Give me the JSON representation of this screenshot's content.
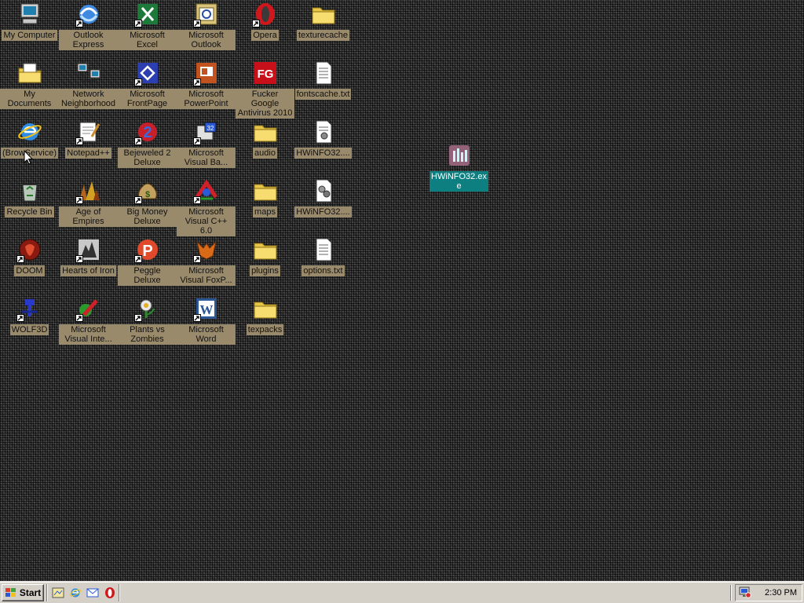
{
  "desktop": {
    "icons": [
      {
        "id": "my-computer",
        "label": "My Computer",
        "icon": "my-computer-icon",
        "shortcut": false
      },
      {
        "id": "outlook-express",
        "label": "Outlook Express",
        "icon": "outlook-express-icon",
        "shortcut": true
      },
      {
        "id": "microsoft-excel",
        "label": "Microsoft Excel",
        "icon": "excel-icon",
        "shortcut": true
      },
      {
        "id": "microsoft-outlook",
        "label": "Microsoft Outlook",
        "icon": "outlook-icon",
        "shortcut": true
      },
      {
        "id": "opera",
        "label": "Opera",
        "icon": "opera-icon",
        "shortcut": true
      },
      {
        "id": "texturecache",
        "label": "texturecache",
        "icon": "folder-icon",
        "shortcut": false
      },
      {
        "id": "my-documents",
        "label": "My Documents",
        "icon": "my-documents-icon",
        "shortcut": false
      },
      {
        "id": "network-neighborhood",
        "label": "Network Neighborhood",
        "icon": "network-icon",
        "shortcut": false
      },
      {
        "id": "microsoft-frontpage",
        "label": "Microsoft FrontPage",
        "icon": "frontpage-icon",
        "shortcut": true
      },
      {
        "id": "microsoft-powerpoint",
        "label": "Microsoft PowerPoint",
        "icon": "powerpoint-icon",
        "shortcut": true
      },
      {
        "id": "fucker-google",
        "label": "Fucker Google Antivirus 2010",
        "icon": "fg-antivirus-icon",
        "shortcut": false
      },
      {
        "id": "fontscache",
        "label": "fontscache.txt",
        "icon": "text-file-icon",
        "shortcut": false
      },
      {
        "id": "browservice",
        "label": "(BrowService)",
        "icon": "internet-explorer-icon",
        "shortcut": false
      },
      {
        "id": "notepadpp",
        "label": "Notepad++",
        "icon": "notepad-icon",
        "shortcut": true
      },
      {
        "id": "bejeweled",
        "label": "Bejeweled 2 Deluxe",
        "icon": "bejeweled-icon",
        "shortcut": true
      },
      {
        "id": "visual-basic",
        "label": "Microsoft Visual Ba...",
        "icon": "visual-basic-icon",
        "shortcut": true
      },
      {
        "id": "audio",
        "label": "audio",
        "icon": "folder-icon",
        "shortcut": false
      },
      {
        "id": "hwinfo-1",
        "label": "HWiNFO32....",
        "icon": "config-file-icon",
        "shortcut": false
      },
      {
        "id": "recycle-bin",
        "label": "Recycle Bin",
        "icon": "recycle-bin-icon",
        "shortcut": false
      },
      {
        "id": "age-of-empires",
        "label": "Age of Empires",
        "icon": "age-of-empires-icon",
        "shortcut": true
      },
      {
        "id": "big-money",
        "label": "Big Money Deluxe",
        "icon": "money-bag-icon",
        "shortcut": true
      },
      {
        "id": "visual-cpp",
        "label": "Microsoft Visual C++ 6.0",
        "icon": "visual-cpp-icon",
        "shortcut": true
      },
      {
        "id": "maps",
        "label": "maps",
        "icon": "folder-icon",
        "shortcut": false
      },
      {
        "id": "hwinfo-2",
        "label": "HWiNFO32....",
        "icon": "settings-file-icon",
        "shortcut": false
      },
      {
        "id": "doom",
        "label": "DOOM",
        "icon": "doom-icon",
        "shortcut": true
      },
      {
        "id": "hearts-of-iron",
        "label": "Hearts of Iron",
        "icon": "hearts-of-iron-icon",
        "shortcut": true
      },
      {
        "id": "peggle",
        "label": "Peggle Deluxe",
        "icon": "peggle-icon",
        "shortcut": true
      },
      {
        "id": "visual-foxpro",
        "label": "Microsoft Visual FoxP...",
        "icon": "foxpro-icon",
        "shortcut": true
      },
      {
        "id": "plugins",
        "label": "plugins",
        "icon": "folder-icon",
        "shortcut": false
      },
      {
        "id": "options",
        "label": "options.txt",
        "icon": "text-file-icon",
        "shortcut": false
      },
      {
        "id": "wolf3d",
        "label": "WOLF3D",
        "icon": "wolf3d-icon",
        "shortcut": true
      },
      {
        "id": "visual-interdev",
        "label": "Microsoft Visual Inte...",
        "icon": "visual-interdev-icon",
        "shortcut": true
      },
      {
        "id": "plants-vs-zombies",
        "label": "Plants vs Zombies",
        "icon": "plants-vs-zombies-icon",
        "shortcut": true
      },
      {
        "id": "microsoft-word",
        "label": "Microsoft Word",
        "icon": "word-icon",
        "shortcut": true
      },
      {
        "id": "texpacks",
        "label": "texpacks",
        "icon": "folder-icon",
        "shortcut": false
      },
      {
        "id": "hwinfo-exe",
        "label": "HWiNFO32.exe",
        "icon": "hwinfo-icon",
        "shortcut": false,
        "selected": true
      }
    ]
  },
  "taskbar": {
    "start_label": "Start",
    "quicklaunch": [
      "show-desktop-icon",
      "internet-explorer-icon",
      "outlook-express-icon",
      "opera-icon"
    ],
    "tray_icon": "tray-monitor-icon",
    "clock": "2:30 PM"
  },
  "colors": {
    "label_bg": "#9a8a6c",
    "selected_bg": "#0e7f80",
    "taskbar": "#d4d0c8"
  }
}
